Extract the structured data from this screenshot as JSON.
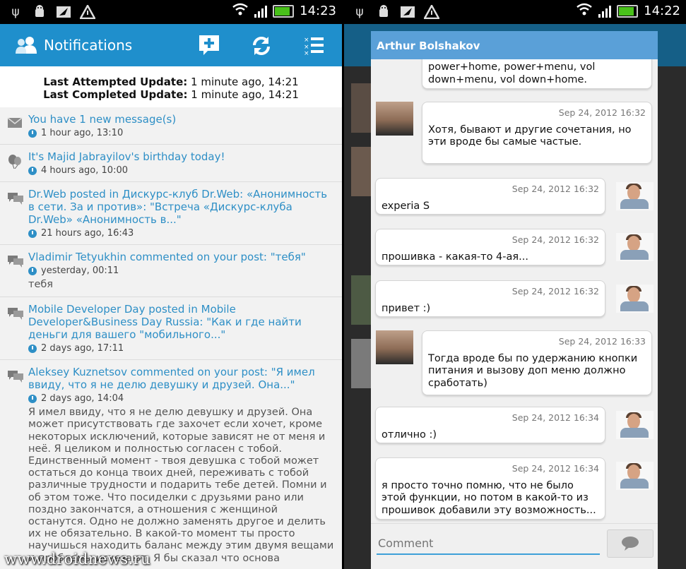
{
  "left": {
    "status": {
      "time": "14:23"
    },
    "header": {
      "title": "Notifications",
      "icons": [
        "add-post-icon",
        "refresh-icon",
        "list-icon"
      ]
    },
    "updates": {
      "attempted_label": "Last Attempted Update:",
      "attempted_value": " 1 minute ago, 14:21",
      "completed_label": "Last Completed Update:",
      "completed_value": " 1 minute ago, 14:21"
    },
    "notifications": [
      {
        "icon": "envelope-icon",
        "title": "You have 1 new message(s)",
        "time": "1 hour ago, 13:10",
        "body": ""
      },
      {
        "icon": "balloons-icon",
        "title": "It's Majid Jabrayilov's birthday today!",
        "time": "4 hours ago, 10:00",
        "body": ""
      },
      {
        "icon": "comments-icon",
        "title": "Dr.Web posted in Дискурс-клуб Dr.Web: «Анонимность в сети. За и против»: \"Встреча «Дискурс-клуба Dr.Web» «Анонимность в...\"",
        "time": "21 hours ago, 16:43",
        "body": ""
      },
      {
        "icon": "comments-icon",
        "title": "Vladimir Tetyukhin commented on your post: \"тебя\"",
        "time": "yesterday, 00:11",
        "body": "тебя"
      },
      {
        "icon": "comments-icon",
        "title": "Mobile Developer Day posted in Mobile Developer&Business Day Russia: \"Как и где найти деньги для вашего \"мобильного...\"",
        "time": "2 days ago, 17:11",
        "body": ""
      },
      {
        "icon": "comments-icon",
        "title": "Aleksey Kuznetsov commented on your post: \"Я имел ввиду, что я не делю девушку и друзей. Она...\"",
        "time": "2 days ago, 14:04",
        "body": "Я имел ввиду, что я не делю девушку и друзей. Она может присутствовать где захочет если хочет, кроме некоторых исключений, которые зависят не от меня и неё. Я целиком и полностью согласен с тобой. Единственный момент - твоя девушка с тобой может остаться до конца твоих дней, переживать с тобой различные трудности и подарить тебе детей. Помни и об этом тоже. Что посиделки с друзьями рано или поздно закончатся, а отношения с женщиной останутся. Одно не должно заменять другое и делить их не обязательно. В какой-то момент ты просто научишься находить баланс между этим двумя вещами и проблемы исчезают. Я бы сказал что основа"
      }
    ],
    "watermark": "www.droidnews.ru"
  },
  "right": {
    "status": {
      "time": "14:22"
    },
    "dialog": {
      "title": "Arthur Bolshakov",
      "messages": [
        {
          "side": "incoming",
          "time": "",
          "text": "power+home, power+menu, vol down+menu, vol down+home."
        },
        {
          "side": "outgoing",
          "time": "Sep 24, 2012 16:32",
          "text": "Хотя, бывают и другие сочетания, но эти вроде бы самые частые."
        },
        {
          "side": "incoming",
          "time": "Sep 24, 2012 16:32",
          "text": "experia S"
        },
        {
          "side": "incoming",
          "time": "Sep 24, 2012 16:32",
          "text": "прошивка - какая-то 4-ая..."
        },
        {
          "side": "incoming",
          "time": "Sep 24, 2012 16:32",
          "text": "привет :)"
        },
        {
          "side": "outgoing",
          "time": "Sep 24, 2012 16:33",
          "text": "Тогда вроде бы по удержанию кнопки питания и вызову доп меню должно сработать)"
        },
        {
          "side": "incoming",
          "time": "Sep 24, 2012 16:34",
          "text": "отлично :)"
        },
        {
          "side": "incoming",
          "time": "Sep 24, 2012 16:34",
          "text": "я просто точно помню, что не было этой функции, но потом в какой-то из прошивок добавили эту возможность..."
        }
      ],
      "comment_placeholder": "Comment",
      "send_icon": "speech-bubble-icon"
    }
  },
  "colors": {
    "actionbar": "#1f8fcc",
    "link": "#2e8fc6",
    "dialog_title": "#5aa0d8"
  }
}
